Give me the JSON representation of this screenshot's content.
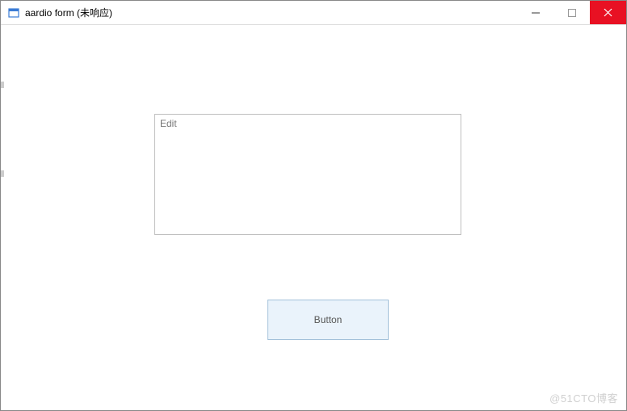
{
  "window": {
    "title": "aardio form (未响应)"
  },
  "form": {
    "edit_placeholder": "Edit",
    "button_label": "Button"
  },
  "watermark": "@51CTO博客"
}
